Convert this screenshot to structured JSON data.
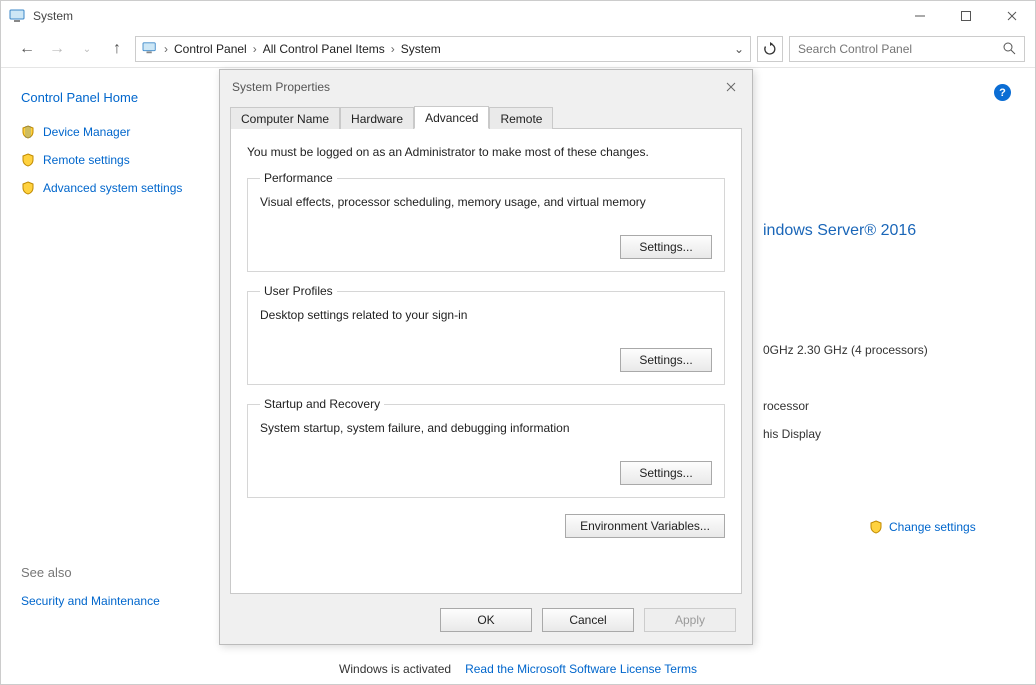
{
  "window": {
    "title": "System"
  },
  "nav": {
    "breadcrumb": [
      "Control Panel",
      "All Control Panel Items",
      "System"
    ]
  },
  "search": {
    "placeholder": "Search Control Panel"
  },
  "sidebar": {
    "home": "Control Panel Home",
    "items": [
      {
        "label": "Device Manager"
      },
      {
        "label": "Remote settings"
      },
      {
        "label": "Advanced system settings"
      }
    ],
    "see_also_heading": "See also",
    "see_also_item": "Security and Maintenance"
  },
  "main": {
    "edition_suffix": "indows Server® 2016",
    "spec_cpu": "0GHz   2.30 GHz  (4 processors)",
    "spec_proc": "rocessor",
    "spec_display": "his Display",
    "change_settings": "Change settings"
  },
  "footer": {
    "activated": "Windows is activated",
    "license_link": "Read the Microsoft Software License Terms"
  },
  "dialog": {
    "title": "System Properties",
    "tabs": [
      "Computer Name",
      "Hardware",
      "Advanced",
      "Remote"
    ],
    "active_tab": 2,
    "note": "You must be logged on as an Administrator to make most of these changes.",
    "groups": [
      {
        "legend": "Performance",
        "desc": "Visual effects, processor scheduling, memory usage, and virtual memory",
        "button": "Settings..."
      },
      {
        "legend": "User Profiles",
        "desc": "Desktop settings related to your sign-in",
        "button": "Settings..."
      },
      {
        "legend": "Startup and Recovery",
        "desc": "System startup, system failure, and debugging information",
        "button": "Settings..."
      }
    ],
    "env_button": "Environment Variables...",
    "ok": "OK",
    "cancel": "Cancel",
    "apply": "Apply"
  }
}
